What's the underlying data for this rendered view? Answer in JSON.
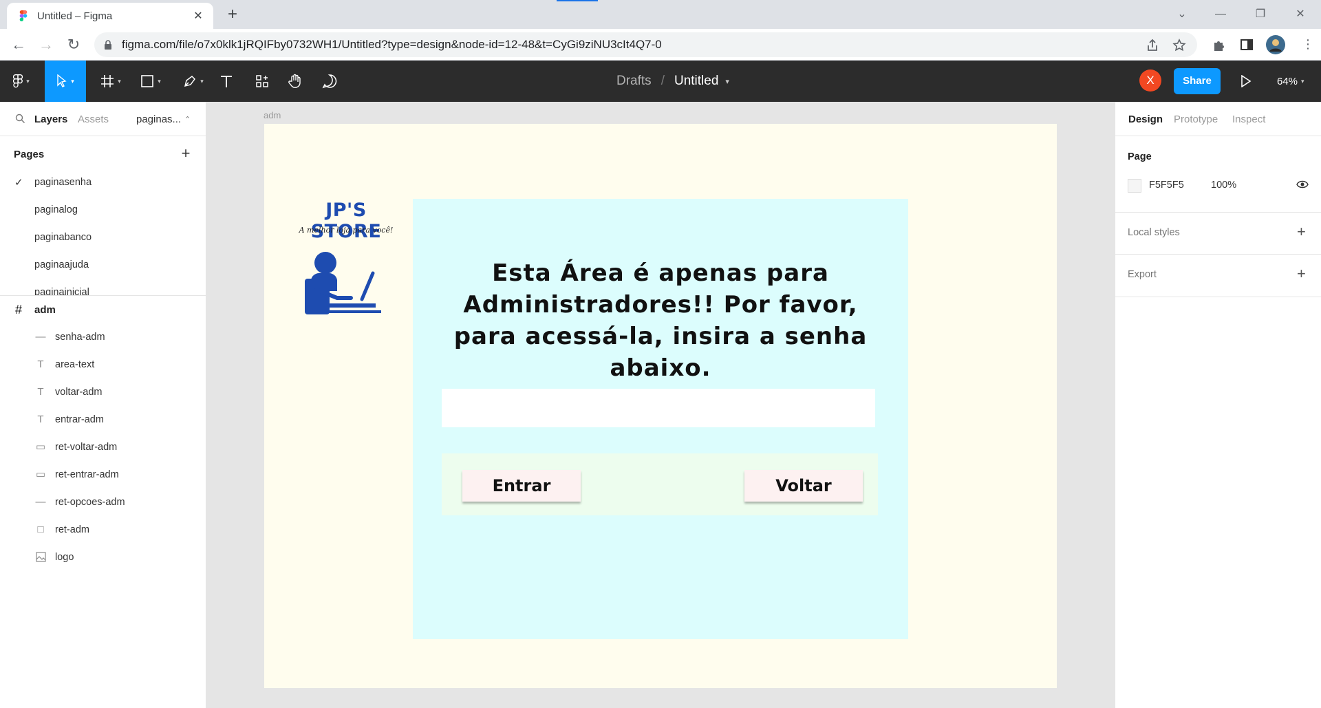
{
  "browser": {
    "tab_title": "Untitled – Figma",
    "url": "figma.com/file/o7x0klk1jRQIFby0732WH1/Untitled?type=design&node-id=12-48&t=CyGi9ziNU3cIt4Q7-0"
  },
  "toolbar": {
    "drafts": "Drafts",
    "separator": "/",
    "file_name": "Untitled",
    "user_initial": "X",
    "share_label": "Share",
    "zoom": "64%",
    "accent": "#0d99ff"
  },
  "left_panel": {
    "tabs": {
      "layers": "Layers",
      "assets": "Assets",
      "current_page": "paginas..."
    },
    "pages_title": "Pages",
    "pages": [
      "paginasenha",
      "paginalog",
      "paginabanco",
      "paginaajuda",
      "paginainicial"
    ],
    "frame_name": "adm",
    "layers": [
      {
        "name": "senha-adm",
        "icon": "line-icon"
      },
      {
        "name": "area-text",
        "icon": "text-icon"
      },
      {
        "name": "voltar-adm",
        "icon": "text-icon"
      },
      {
        "name": "entrar-adm",
        "icon": "text-icon"
      },
      {
        "name": "ret-voltar-adm",
        "icon": "rectangle-icon"
      },
      {
        "name": "ret-entrar-adm",
        "icon": "rectangle-icon"
      },
      {
        "name": "ret-opcoes-adm",
        "icon": "line-icon"
      },
      {
        "name": "ret-adm",
        "icon": "rectangle-icon"
      },
      {
        "name": "logo",
        "icon": "image-icon"
      }
    ]
  },
  "canvas": {
    "frame_label": "adm",
    "logo_brand": "JP'S STORE",
    "logo_tagline": "A melhor loja para você!",
    "headline": "Esta Área é apenas para Administradores!! Por favor, para acessá-la, insira a senha abaixo.",
    "password_value": "",
    "enter_label": "Entrar",
    "back_label": "Voltar",
    "colors": {
      "frame_bg": "#fffdee",
      "ret_adm": "#dcfdfd",
      "ret_opcoes": "#edfdee",
      "button_bg": "#fdf1f1",
      "logo_blue": "#1e4cb0"
    }
  },
  "right_panel": {
    "tabs": {
      "design": "Design",
      "prototype": "Prototype",
      "inspect": "Inspect"
    },
    "page_title": "Page",
    "page_color": "F5F5F5",
    "page_opacity": "100%",
    "local_styles": "Local styles",
    "export": "Export"
  },
  "help_label": "?"
}
